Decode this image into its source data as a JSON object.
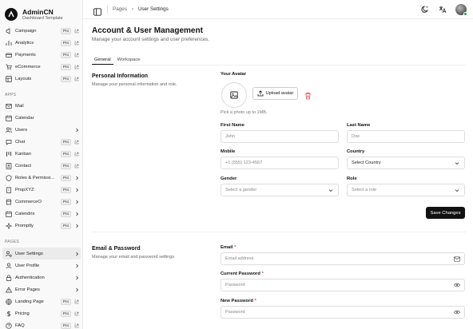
{
  "brand": {
    "title": "AdminCN",
    "subtitle": "Dashboard Template"
  },
  "sidebar": {
    "top_items": [
      {
        "label": "Campaign",
        "badge": "Pro",
        "icon": "megaphone-icon"
      },
      {
        "label": "Analytics",
        "badge": "Pro",
        "icon": "chart-icon"
      },
      {
        "label": "Payments",
        "badge": "Pro",
        "icon": "card-icon"
      },
      {
        "label": "eCommerce",
        "badge": "Pro",
        "icon": "cart-icon"
      },
      {
        "label": "Layouts",
        "badge": "Pro",
        "icon": "layout-icon"
      }
    ],
    "apps_label": "APPS",
    "apps_items": [
      {
        "label": "Mail",
        "icon": "mail-icon"
      },
      {
        "label": "Calendar",
        "icon": "calendar-icon"
      },
      {
        "label": "Users",
        "icon": "users-icon",
        "chevron": true
      },
      {
        "label": "Chat",
        "badge": "Pro",
        "icon": "chat-icon"
      },
      {
        "label": "Kanban",
        "badge": "Pro",
        "icon": "kanban-icon"
      },
      {
        "label": "Contact",
        "badge": "Pro",
        "icon": "contact-icon"
      },
      {
        "label": "Roles & Permissi...",
        "badge": "Pro",
        "icon": "shield-icon",
        "chevron": true
      },
      {
        "label": "PropXYZ",
        "badge": "Pro",
        "icon": "building-icon",
        "chevron": true
      },
      {
        "label": "CommerceO",
        "badge": "Pro",
        "icon": "store-icon",
        "chevron": true
      },
      {
        "label": "Calendrix",
        "badge": "Pro",
        "icon": "calendar-icon",
        "chevron": true
      },
      {
        "label": "Promptly",
        "badge": "Pro",
        "icon": "sparkle-icon",
        "chevron": true
      }
    ],
    "pages_label": "PAGES",
    "pages_items": [
      {
        "label": "User Settings",
        "icon": "user-cog-icon",
        "chevron": true,
        "active": true
      },
      {
        "label": "User Profile",
        "icon": "user-icon",
        "chevron": true
      },
      {
        "label": "Authentication",
        "icon": "lock-icon",
        "chevron": true
      },
      {
        "label": "Error Pages",
        "icon": "alert-icon",
        "chevron": true
      },
      {
        "label": "Landing Page",
        "badge": "Pro",
        "icon": "globe-icon"
      },
      {
        "label": "Pricing",
        "badge": "Pro",
        "icon": "dollar-icon"
      },
      {
        "label": "FAQ",
        "badge": "Pro",
        "icon": "help-icon"
      }
    ]
  },
  "topbar": {
    "breadcrumbs": [
      "Pages",
      "User Settings"
    ],
    "breadcrumb_sep": "›"
  },
  "main": {
    "title": "Account & User Management",
    "subtitle": "Manage your account settings and user preferences.",
    "tabs": [
      {
        "label": "General",
        "active": true
      },
      {
        "label": "Workspace",
        "active": false
      }
    ]
  },
  "personal": {
    "title": "Personal Information",
    "desc": "Manage your personal information and role.",
    "avatar_label": "Your Avatar",
    "upload_label": "Upload avatar",
    "pick_note": "Pick a photo up to 1MB.",
    "first_name": {
      "label": "First Name",
      "placeholder": "John"
    },
    "last_name": {
      "label": "Last Name",
      "placeholder": "Doe"
    },
    "mobile": {
      "label": "Mobile",
      "value": "+1 (555) 123-4567"
    },
    "country": {
      "label": "Country",
      "value": "Select Country"
    },
    "gender": {
      "label": "Gender",
      "value": "Select a gender"
    },
    "role": {
      "label": "Role",
      "value": "Select a role"
    },
    "save_label": "Save Changes"
  },
  "email_password": {
    "title": "Email & Password",
    "desc": "Manage your email and password settings.",
    "email": {
      "label": "Email",
      "required": "*",
      "placeholder": "Email address"
    },
    "current_password": {
      "label": "Current Password",
      "required": "*",
      "placeholder": "Password"
    },
    "new_password": {
      "label": "New Password",
      "required": "*",
      "placeholder": "Password"
    }
  }
}
